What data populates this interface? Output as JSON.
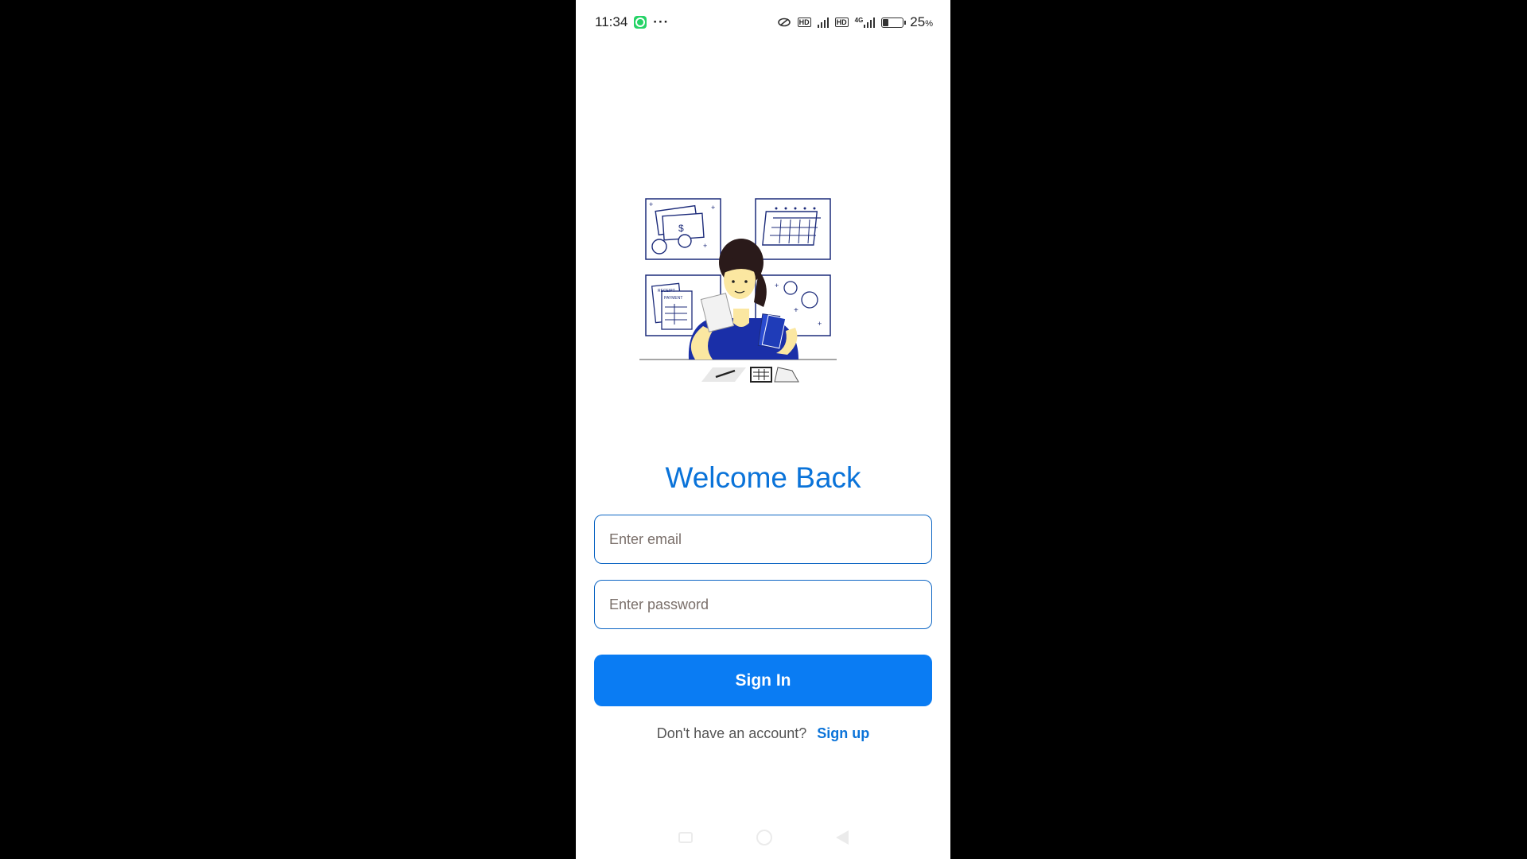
{
  "status_bar": {
    "time": "11:34",
    "more_indicator": "···",
    "battery_percent": "25",
    "battery_unit": "%",
    "battery_level": 0.25,
    "network_label": "4G",
    "hd_label": "HD",
    "icons": [
      "whatsapp-icon",
      "link-icon",
      "hd-icon",
      "signal-icon",
      "battery-icon"
    ]
  },
  "login": {
    "title": "Welcome Back",
    "email_placeholder": "Enter email",
    "password_placeholder": "Enter password",
    "sign_in_label": "Sign In",
    "no_account_text": "Don't have an account?",
    "sign_up_label": "Sign up"
  },
  "illustration": {
    "dollar_sign": "$",
    "receipt_label": "RECEIPT",
    "payment_label": "PAYMENT"
  },
  "colors": {
    "accent": "#0a73d9",
    "button": "#0a7cf3",
    "field_border": "#0e66c4",
    "shirt": "#1a2fa8"
  }
}
